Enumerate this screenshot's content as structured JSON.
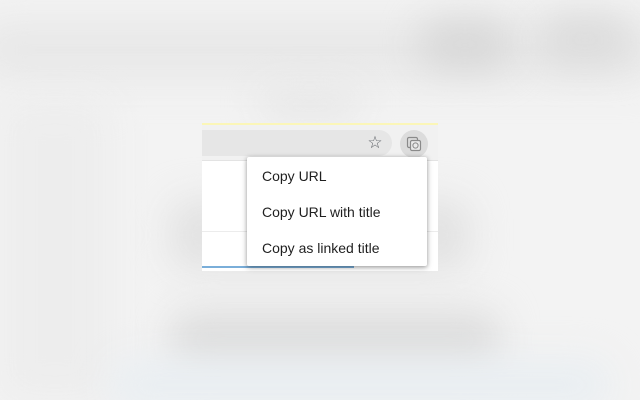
{
  "toolbar": {
    "bookmark_icon": "star-outline-icon",
    "extension_icon": "copy-url-extension-icon"
  },
  "menu": {
    "items": [
      {
        "label": "Copy URL"
      },
      {
        "label": "Copy URL with title"
      },
      {
        "label": "Copy as linked title"
      }
    ]
  },
  "colors": {
    "accent_line": "#fbf6b8",
    "link_underline": "#7aaed9"
  }
}
